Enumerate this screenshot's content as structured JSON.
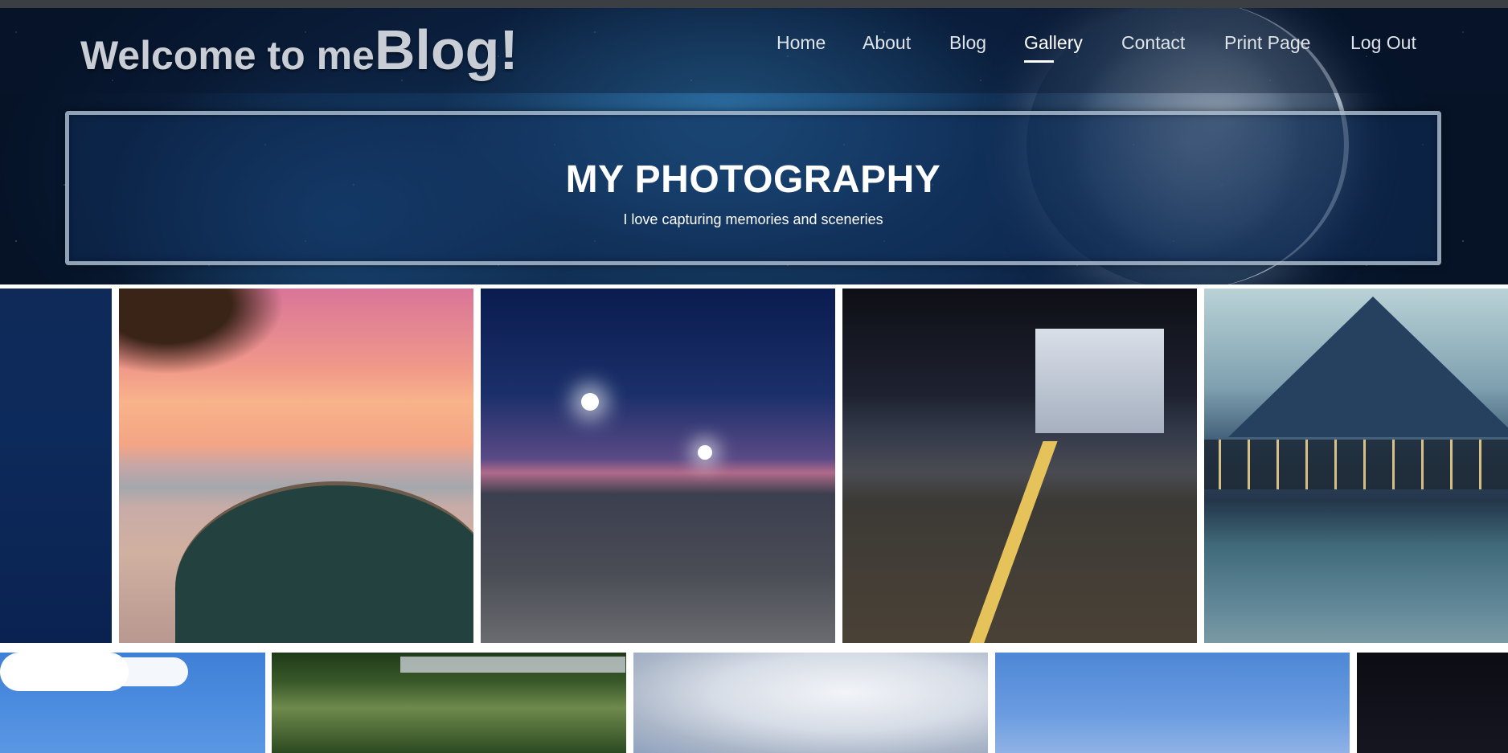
{
  "site": {
    "title_prefix": "Welcome to me",
    "title_emphasis": "Blog!"
  },
  "nav": {
    "items": [
      {
        "label": "Home",
        "active": false
      },
      {
        "label": "About",
        "active": false
      },
      {
        "label": "Blog",
        "active": false
      },
      {
        "label": "Gallery",
        "active": true
      },
      {
        "label": "Contact",
        "active": false
      },
      {
        "label": "Print Page",
        "active": false
      },
      {
        "label": "Log Out",
        "active": false
      }
    ]
  },
  "banner": {
    "title": "MY PHOTOGRAPHY",
    "subtitle": "I love capturing memories and sceneries"
  },
  "colors": {
    "nav_text": "#dfe4ea",
    "active_underline": "#ffffff",
    "banner_background": "#102c58",
    "banner_border": "#becdda"
  },
  "gallery": {
    "row1": [
      "ocean",
      "beach-sunset-tent",
      "street-night",
      "city-crosswalk-night",
      "volcano-lake"
    ],
    "row2": [
      "blue-sky",
      "jungle-bridge",
      "clouds",
      "blue-sky-2",
      "dark"
    ]
  }
}
